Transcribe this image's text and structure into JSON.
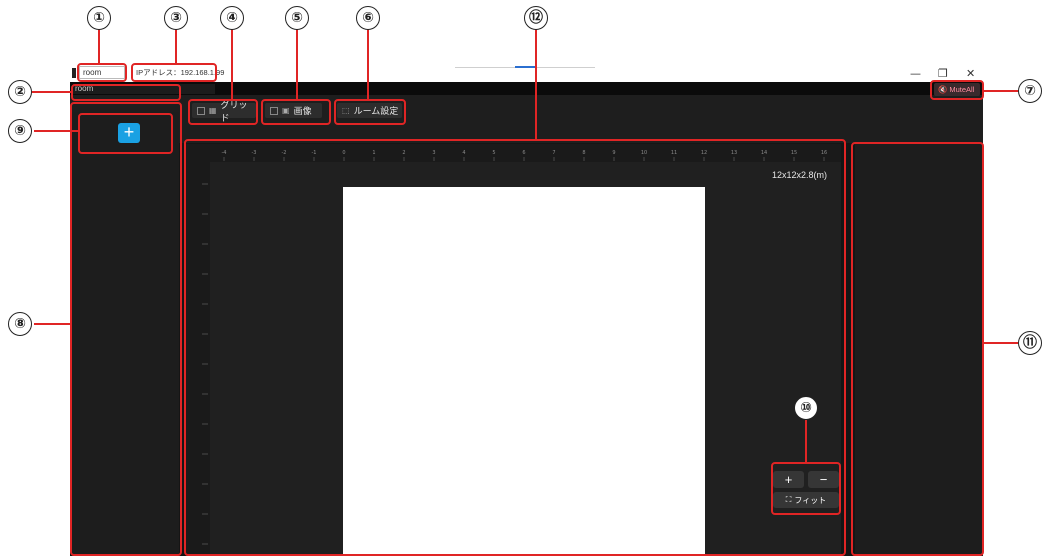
{
  "window": {
    "tab_label": "room",
    "room_label": "room",
    "ip_text": "IPアドレス：192.168.1.99",
    "controls": {
      "minimize": "—",
      "restore": "❐",
      "close": "✕"
    }
  },
  "toolbar": {
    "grid_label": "グリッド",
    "image_label": "画像",
    "room_settings_label": "ルーム設定",
    "mute_all_label": "MuteAll"
  },
  "sidebar": {
    "add_button_symbol": "+"
  },
  "canvas": {
    "room_size": "12x12x2.8(m)",
    "ruler_x": [
      "-4",
      "-3",
      "-2",
      "-1",
      "0",
      "1",
      "2",
      "3",
      "4",
      "5",
      "6",
      "7",
      "8",
      "9",
      "10",
      "11",
      "12",
      "13",
      "14",
      "15",
      "16"
    ]
  },
  "zoom": {
    "plus": "+",
    "minus": "−",
    "fit_label": "フィット"
  },
  "callouts": [
    "①",
    "②",
    "③",
    "④",
    "⑤",
    "⑥",
    "⑦",
    "⑧",
    "⑨",
    "⑩",
    "⑪",
    "⑫"
  ],
  "colors": {
    "accent": "#1aa1e3",
    "annotation": "#e02525",
    "app_bg": "#151515"
  }
}
